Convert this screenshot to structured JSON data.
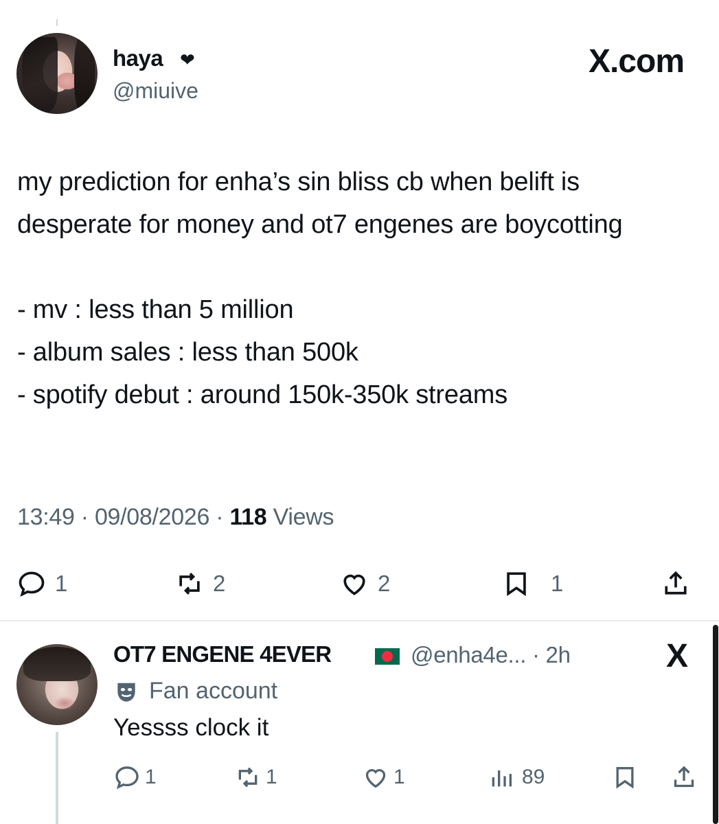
{
  "tweet": {
    "display_name": "haya",
    "heart": "❤",
    "handle": "@miuive",
    "brand": "X.com",
    "text": "my prediction for enha’s sin bliss cb when belift is desperate for money and ot7 engenes are boycotting\n\n- mv : less than 5 million\n- album sales : less than 500k\n- spotify debut : around 150k-350k streams",
    "time": "13:49",
    "date": "09/08/2026",
    "views_count": "118",
    "views_label": "Views",
    "separator": "·",
    "actions": {
      "replies": "1",
      "reposts": "2",
      "likes": "2",
      "bookmarks": "1"
    },
    "icons": [
      "reply-icon",
      "repost-icon",
      "like-icon",
      "bookmark-icon",
      "share-icon"
    ]
  },
  "reply": {
    "display_name": "OT7 ENGENE 4EVER",
    "handle_time": "@enha4e... · 2h",
    "close_glyph": "X",
    "label": "Fan account",
    "text": "Yessss clock it",
    "actions": {
      "replies": "1",
      "reposts": "1",
      "likes": "1",
      "views": "89"
    },
    "icons": [
      "reply-icon",
      "repost-icon",
      "like-icon",
      "views-icon",
      "bookmark-icon",
      "share-icon"
    ]
  },
  "colors": {
    "text": "#0f1419",
    "secondary": "#536471",
    "divider": "#e8ebee",
    "flag_green": "#006a4e",
    "flag_red": "#f42a41"
  }
}
